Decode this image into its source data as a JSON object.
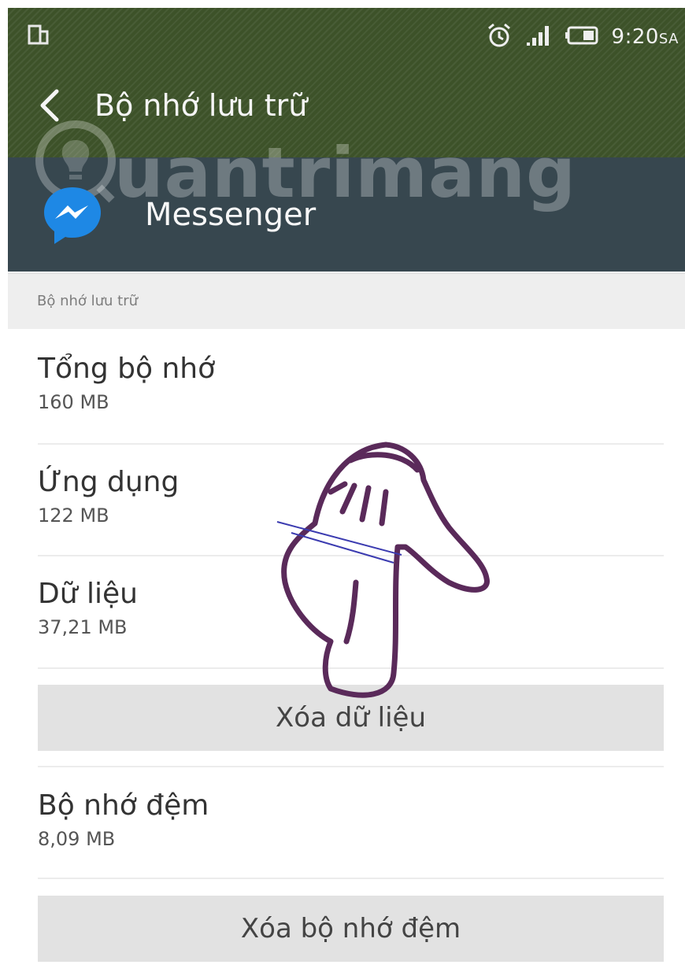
{
  "status_bar": {
    "time": "9:20",
    "time_suffix": "SA",
    "icons": [
      "screen-cast-icon",
      "alarm-clock-icon",
      "signal-icon",
      "battery-icon"
    ]
  },
  "toolbar": {
    "back_icon": "chevron-left-icon",
    "title": "Bộ nhớ lưu trữ"
  },
  "app": {
    "icon": "messenger-icon",
    "name": "Messenger"
  },
  "watermark": {
    "text": "uantrimang"
  },
  "section": {
    "label": "Bộ nhớ lưu trữ"
  },
  "storage": {
    "total": {
      "label": "Tổng bộ nhớ",
      "value": "160 MB"
    },
    "app": {
      "label": "Ứng dụng",
      "value": "122 MB"
    },
    "data": {
      "label": "Dữ liệu",
      "value": "37,21 MB"
    },
    "clear_data_button": "Xóa dữ liệu",
    "cache": {
      "label": "Bộ nhớ đệm",
      "value": "8,09 MB"
    },
    "clear_cache_button": "Xóa bộ nhớ đệm"
  },
  "colors": {
    "status_bar_bg": "#3d5229",
    "app_header_bg": "#37474f",
    "section_header_bg": "#eeeeee",
    "button_bg": "#e2e2e2",
    "pointer_outline": "#5a2a5a",
    "messenger_blue": "#1e88e5"
  }
}
